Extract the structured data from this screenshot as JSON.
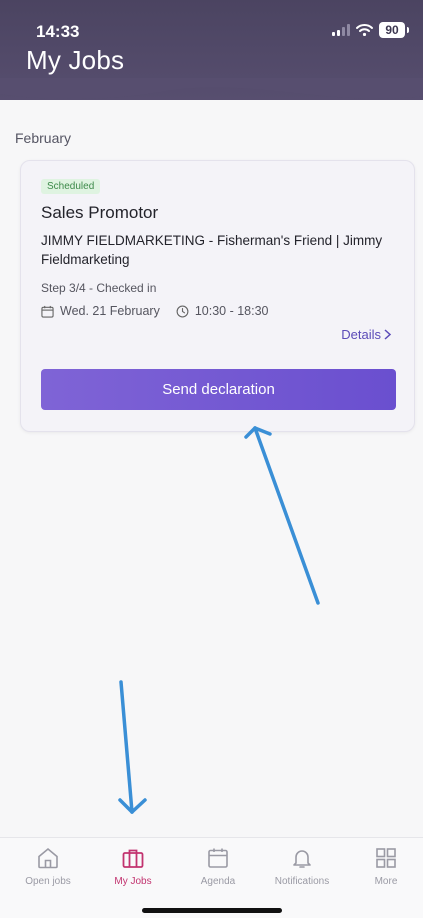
{
  "status_bar": {
    "time": "14:33",
    "battery": "90"
  },
  "header": {
    "title": "My Jobs"
  },
  "section": {
    "month": "February"
  },
  "job": {
    "badge": "Scheduled",
    "title": "Sales Promotor",
    "company": "JIMMY FIELDMARKETING - Fisherman's Friend | Jimmy Fieldmarketing",
    "step": "Step 3/4 - Checked in",
    "date": "Wed. 21 February",
    "time": "10:30 - 18:30",
    "details_label": "Details",
    "send_label": "Send declaration"
  },
  "tabs": [
    {
      "label": "Open jobs",
      "icon": "home-icon"
    },
    {
      "label": "My Jobs",
      "icon": "briefcase-icon",
      "active": true
    },
    {
      "label": "Agenda",
      "icon": "calendar-icon"
    },
    {
      "label": "Notifications",
      "icon": "bell-icon"
    },
    {
      "label": "More",
      "icon": "grid-icon"
    }
  ],
  "colors": {
    "header": "#4f4766",
    "accent": "#6c52d0",
    "active_tab": "#c2336f",
    "badge_bg": "#dff3e1",
    "badge_text": "#3d8a4a",
    "annotation_arrow": "#3a8fd6"
  }
}
